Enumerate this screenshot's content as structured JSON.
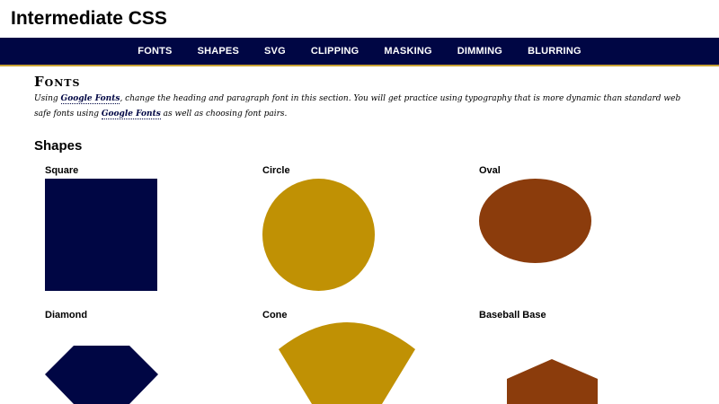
{
  "header": {
    "title": "Intermediate CSS"
  },
  "nav": {
    "items": [
      {
        "label": "FONTS"
      },
      {
        "label": "SHAPES"
      },
      {
        "label": "SVG"
      },
      {
        "label": "CLIPPING"
      },
      {
        "label": "MASKING"
      },
      {
        "label": "DIMMING"
      },
      {
        "label": "BLURRING"
      }
    ]
  },
  "fonts_section": {
    "heading": "Fonts",
    "para_1": "Using ",
    "link_1": "Google Fonts",
    "para_2": ", change the heading and paragraph font in this section. You will get practice using typography that is more dynamic than standard web safe fonts using ",
    "link_2": "Google Fonts",
    "para_3": " as well as choosing font pairs."
  },
  "shapes_section": {
    "heading": "Shapes",
    "labels": {
      "square": "Square",
      "circle": "Circle",
      "oval": "Oval",
      "diamond": "Diamond",
      "cone": "Cone",
      "baseball_base": "Baseball Base"
    }
  },
  "colors": {
    "navy": "#000644",
    "gold": "#c09104",
    "brown": "#8b3c0c",
    "nav_border": "#c8a234"
  }
}
